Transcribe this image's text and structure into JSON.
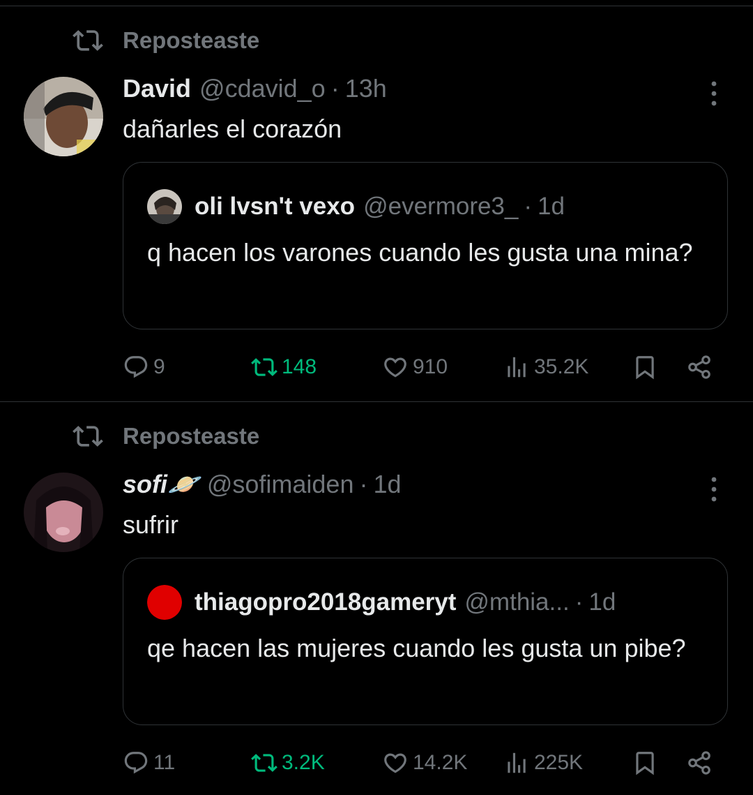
{
  "posts": [
    {
      "repost_label": "Reposteaste",
      "author": {
        "name": "David",
        "handle": "@cdavid_o",
        "time": "13h"
      },
      "text": "dañarles el corazón",
      "quote": {
        "author": {
          "name": "oli lvsn't vexo",
          "handle": "@evermore3_",
          "time": "1d"
        },
        "text": "q hacen los varones cuando les gusta una mina?"
      },
      "stats": {
        "replies": "9",
        "reposts": "148",
        "likes": "910",
        "views": "35.2K"
      }
    },
    {
      "repost_label": "Reposteaste",
      "author": {
        "name": "sofi🪐",
        "handle": "@sofimaiden",
        "time": "1d"
      },
      "text": "sufrir",
      "quote": {
        "author": {
          "name": "thiagopro2018gameryt",
          "handle": "@mthia...",
          "time": "1d"
        },
        "text": "qe hacen las mujeres cuando les gusta un pibe?"
      },
      "stats": {
        "replies": "11",
        "reposts": "3.2K",
        "likes": "14.2K",
        "views": "225K"
      }
    }
  ],
  "colors": {
    "background": "#000000",
    "text": "#e7e9ea",
    "muted": "#71767b",
    "repost_active": "#00ba7c",
    "border": "#2f3336"
  },
  "icons": [
    "repost-icon",
    "more-icon",
    "reply-icon",
    "like-icon",
    "views-icon",
    "bookmark-icon",
    "share-icon"
  ]
}
